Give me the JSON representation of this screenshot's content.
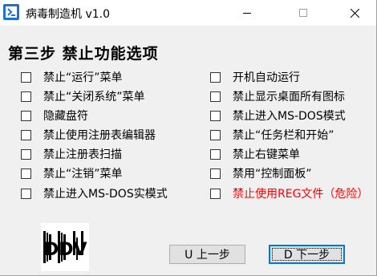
{
  "window": {
    "title": "病毒制造机 v1.0",
    "icon": "app-icon",
    "controls": [
      "minimize-icon",
      "maximize-icon",
      "close-icon"
    ]
  },
  "step_title": "第三步  禁止功能选项",
  "options_left": [
    {
      "label": "禁止“运行”菜单",
      "checked": false
    },
    {
      "label": "禁止“关闭系统”菜单",
      "checked": false
    },
    {
      "label": "隐藏盘符",
      "checked": false
    },
    {
      "label": "禁止使用注册表编辑器",
      "checked": false
    },
    {
      "label": "禁止注册表扫描",
      "checked": false
    },
    {
      "label": "禁止“注销”菜单",
      "checked": false
    },
    {
      "label": "禁止进入MS-DOS实模式",
      "checked": false
    }
  ],
  "options_right": [
    {
      "label": "开机自动运行",
      "checked": false
    },
    {
      "label": "禁止显示桌面所有图标",
      "checked": false
    },
    {
      "label": "禁止进入MS-DOS模式",
      "checked": false
    },
    {
      "label": "禁止“任务栏和开始”",
      "checked": false
    },
    {
      "label": "禁止右键菜单",
      "checked": false
    },
    {
      "label": "禁用“控制面板”",
      "checked": false
    },
    {
      "label": "禁止使用REG文件（危险）",
      "checked": false,
      "color": "#ff0000"
    }
  ],
  "logo_text": "DDV",
  "buttons": {
    "prev_label": "U 上一步",
    "next_label": "D 下一步"
  },
  "colors": {
    "background": "#f0f0f0",
    "titlebar": "#ffffff",
    "accent": "#0078d7",
    "danger": "#ff0000"
  }
}
